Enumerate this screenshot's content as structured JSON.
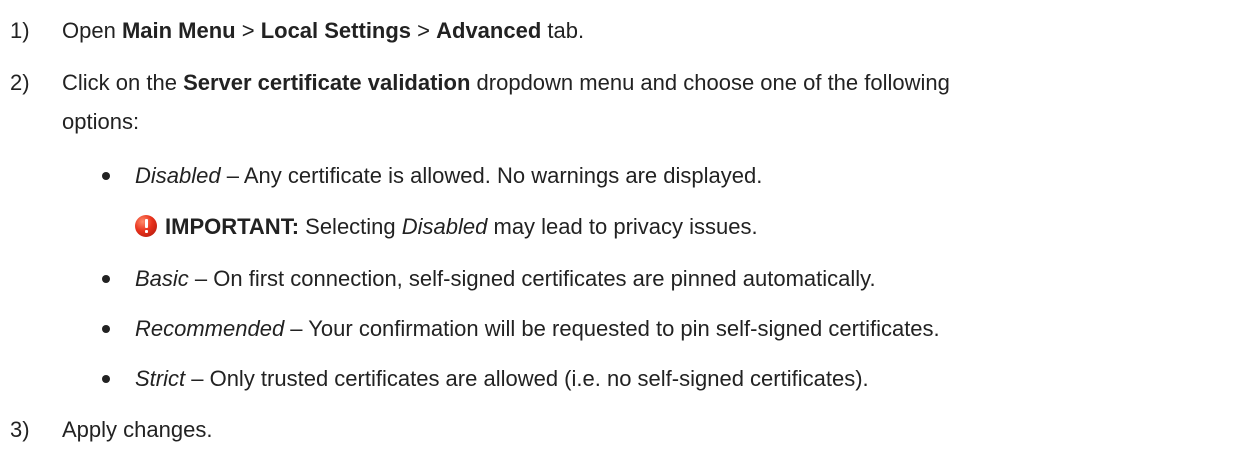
{
  "steps": [
    {
      "number": "1)",
      "parts": {
        "t1": "Open ",
        "b1": "Main Menu",
        "t2": " > ",
        "b2": "Local Settings",
        "t3": " > ",
        "b3": "Advanced",
        "t4": " tab."
      }
    },
    {
      "number": "2)",
      "parts": {
        "t1": "Click on the ",
        "b1": "Server certificate validation",
        "t2": " dropdown menu and choose one of the following",
        "t3": "options:"
      }
    },
    {
      "number": "3)",
      "parts": {
        "t1": "Apply changes."
      }
    }
  ],
  "options": [
    {
      "name": "Disabled",
      "desc": " – Any certificate is allowed. No warnings are displayed."
    },
    {
      "name": "Basic",
      "desc": " – On first connection, self-signed certificates are pinned automatically."
    },
    {
      "name": "Recommended",
      "desc": " – Your confirmation will be requested to pin self-signed certificates."
    },
    {
      "name": "Strict",
      "desc": " – Only trusted certificates are allowed (i.e. no self-signed certificates)."
    }
  ],
  "important": {
    "icon": "warning-icon",
    "label": "IMPORTANT:",
    "t1": " Selecting ",
    "em": "Disabled",
    "t2": " may lead to privacy issues."
  },
  "colors": {
    "text": "#222222",
    "warning": "#e8321c"
  }
}
